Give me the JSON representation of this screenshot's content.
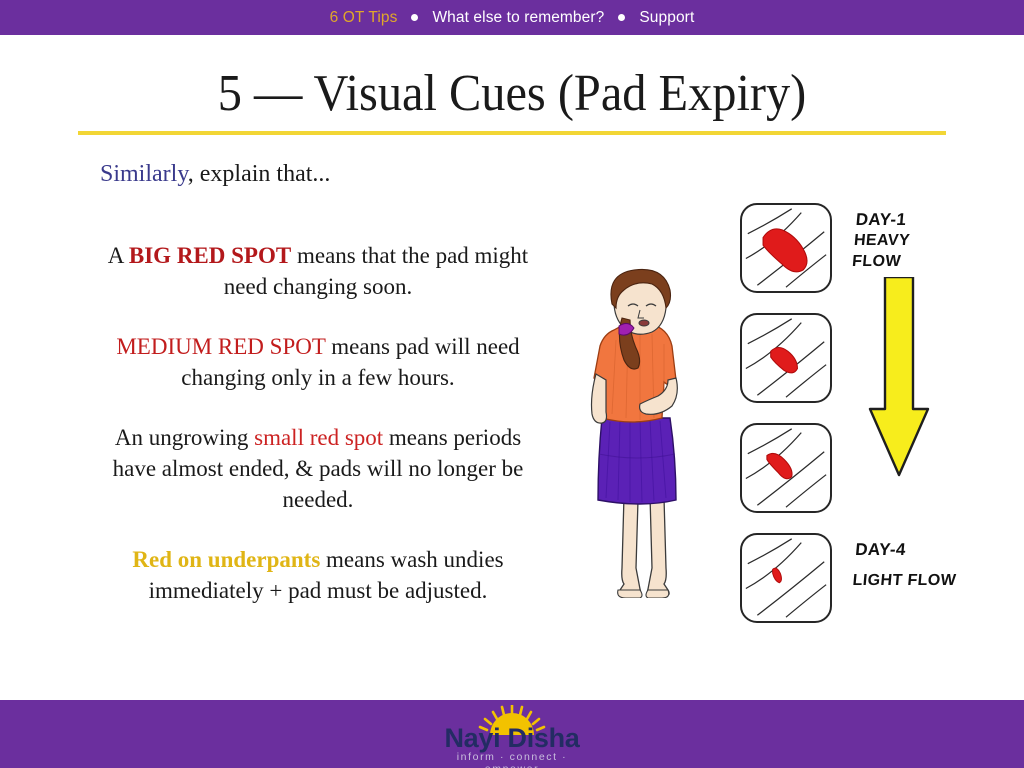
{
  "navbar": {
    "items": [
      {
        "label": "6 OT Tips",
        "active": true
      },
      {
        "label": "What else to remember?",
        "active": false
      },
      {
        "label": "Support",
        "active": false
      }
    ],
    "separator_icon": "bullet-dot",
    "background_color": "#6B2F9E",
    "active_color": "#E0A72A",
    "text_color": "#FFFFFF"
  },
  "title": {
    "text": "5 — Visual Cues (Pad Expiry)",
    "rule_color": "#F2D635"
  },
  "lead": {
    "emphasis": "Similarly",
    "emphasis_color": "#3A3A8C",
    "rest": ", explain that..."
  },
  "paragraphs": [
    {
      "id": "big-red-spot",
      "pre": "A ",
      "highlight": "BIG RED SPOT",
      "highlight_color": "#B3181B",
      "post": " means that the pad might need changing soon."
    },
    {
      "id": "medium-red-spot",
      "pre": "",
      "highlight": "MEDIUM RED SPOT",
      "highlight_color": "#C21D1D",
      "post": " means pad will need changing only in a few hours."
    },
    {
      "id": "small-red-spot",
      "pre": "An ungrowing ",
      "highlight": "small red spot",
      "highlight_color": "#CC2222",
      "post": " means periods have almost ended, & pads will no longer be needed."
    },
    {
      "id": "red-on-underpants",
      "pre": "",
      "highlight": "Red on underpants",
      "highlight_color": "#E0B515",
      "post": " means wash undies immediately + pad must be adjusted."
    }
  ],
  "illustration": {
    "alt": "hand-drawn girl holding her stomach wearing orange shirt and purple skirt",
    "pads_alt": "four hand-drawn pads with decreasing red spots",
    "labels": [
      {
        "line1": "DAY-1",
        "line2": "HEAVY FLOW"
      },
      {
        "line1": "DAY-4",
        "line2": "LIGHT FLOW"
      }
    ],
    "arrow_color": "#F7ED1C",
    "spot_color": "#E01B1B"
  },
  "footer": {
    "logo_name": "Nayi Disha",
    "logo_tagline": "inform · connect · empower",
    "sun_icon": "sunburst-icon",
    "background_color": "#6B2F9E",
    "name_color": "#232C63",
    "sun_color": "#F2C200"
  }
}
